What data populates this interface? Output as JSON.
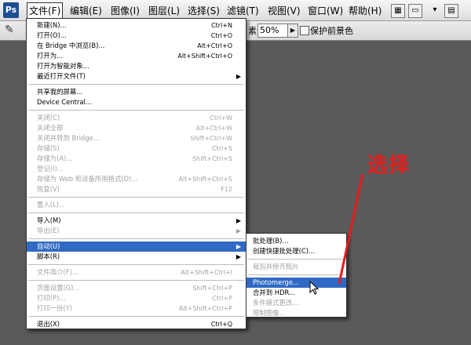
{
  "app": {
    "logo": "Ps"
  },
  "menubar": [
    {
      "label": "文件(F)",
      "active": true
    },
    {
      "label": "编辑(E)"
    },
    {
      "label": "图像(I)"
    },
    {
      "label": "图层(L)"
    },
    {
      "label": "选择(S)"
    },
    {
      "label": "滤镜(T)"
    },
    {
      "label": "视图(V)"
    },
    {
      "label": "窗口(W)"
    },
    {
      "label": "帮助(H)"
    }
  ],
  "toolbar": {
    "feather_label": "素:",
    "feather_value": "50%",
    "keep_label": "保护前景色",
    "icons": [
      "bridge-icon",
      "workspace-dropdown-icon"
    ]
  },
  "file_menu": [
    {
      "label": "新建(N)...",
      "shortcut": "Ctrl+N"
    },
    {
      "label": "打开(O)...",
      "shortcut": "Ctrl+O"
    },
    {
      "label": "在 Bridge 中浏览(B)...",
      "shortcut": "Alt+Ctrl+O"
    },
    {
      "label": "打开为...",
      "shortcut": "Alt+Shift+Ctrl+O"
    },
    {
      "label": "打开为智能对象..."
    },
    {
      "label": "最近打开文件(T)",
      "submenu": true
    },
    {
      "separator": true
    },
    {
      "label": "共享我的屏幕..."
    },
    {
      "label": "Device Central..."
    },
    {
      "separator": true
    },
    {
      "label": "关闭(C)",
      "shortcut": "Ctrl+W",
      "disabled": true
    },
    {
      "label": "关闭全部",
      "shortcut": "Alt+Ctrl+W",
      "disabled": true
    },
    {
      "label": "关闭并转到 Bridge...",
      "shortcut": "Shift+Ctrl+W",
      "disabled": true
    },
    {
      "label": "存储(S)",
      "shortcut": "Ctrl+S",
      "disabled": true
    },
    {
      "label": "存储为(A)...",
      "shortcut": "Shift+Ctrl+S",
      "disabled": true
    },
    {
      "label": "登记(I)...",
      "disabled": true
    },
    {
      "label": "存储为 Web 和设备所用格式(D)...",
      "shortcut": "Alt+Shift+Ctrl+S",
      "disabled": true
    },
    {
      "label": "恢复(V)",
      "shortcut": "F12",
      "disabled": true
    },
    {
      "separator": true
    },
    {
      "label": "置入(L)...",
      "disabled": true
    },
    {
      "separator": true
    },
    {
      "label": "导入(M)",
      "submenu": true
    },
    {
      "label": "导出(E)",
      "submenu": true,
      "disabled": true
    },
    {
      "separator": true
    },
    {
      "label": "自动(U)",
      "submenu": true,
      "highlight": true
    },
    {
      "label": "脚本(R)",
      "submenu": true
    },
    {
      "separator": true
    },
    {
      "label": "文件简介(F)...",
      "shortcut": "Alt+Shift+Ctrl+I",
      "disabled": true
    },
    {
      "separator": true
    },
    {
      "label": "页面设置(G)...",
      "shortcut": "Shift+Ctrl+P",
      "disabled": true
    },
    {
      "label": "打印(P)...",
      "shortcut": "Ctrl+P",
      "disabled": true
    },
    {
      "label": "打印一份(Y)",
      "shortcut": "Alt+Shift+Ctrl+P",
      "disabled": true
    },
    {
      "separator": true
    },
    {
      "label": "退出(X)",
      "shortcut": "Ctrl+Q"
    }
  ],
  "auto_submenu": [
    {
      "label": "批处理(B)..."
    },
    {
      "label": "创建快捷批处理(C)..."
    },
    {
      "separator": true
    },
    {
      "label": "裁剪并修齐照片",
      "disabled": true
    },
    {
      "separator": true
    },
    {
      "label": "Photomerge...",
      "highlight": true
    },
    {
      "label": "合并到 HDR..."
    },
    {
      "label": "条件模式更改...",
      "disabled": true
    },
    {
      "label": "限制图像...",
      "disabled": true
    }
  ],
  "annotation": {
    "text": "选择",
    "color": "#e51b1b"
  },
  "colors": {
    "highlight": "#316ac5",
    "disabled_text": "#a3a3a3",
    "workspace": "#5a5a5a"
  }
}
